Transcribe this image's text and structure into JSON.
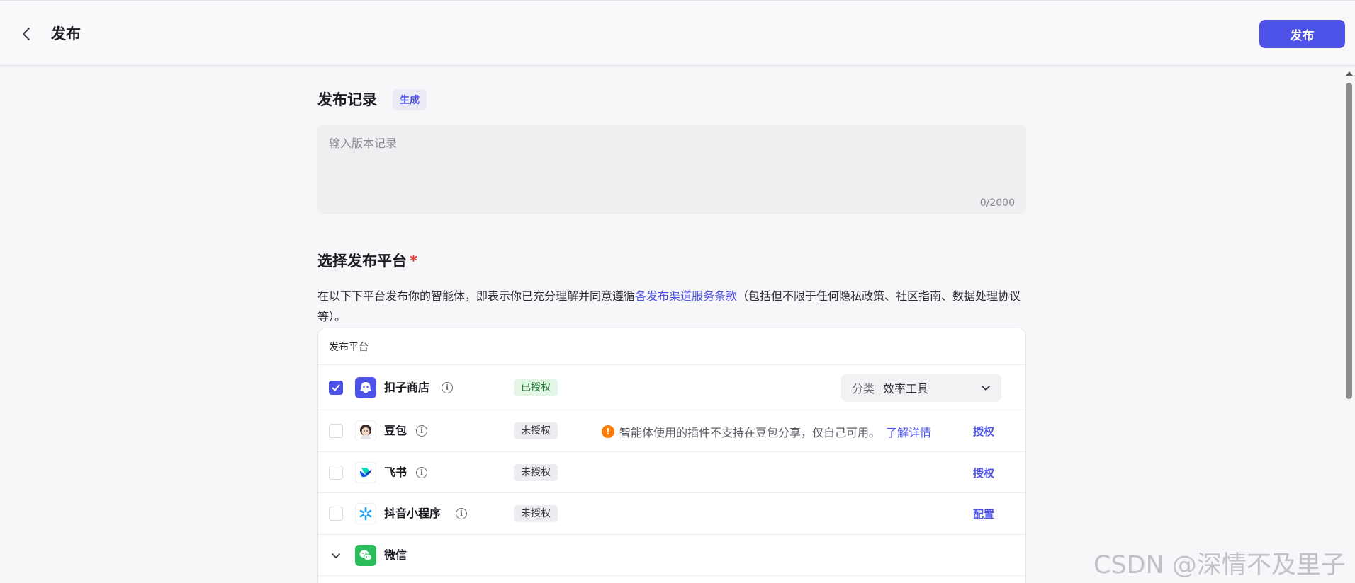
{
  "header": {
    "title": "发布",
    "publish_label": "发布"
  },
  "record": {
    "title": "发布记录",
    "generate_label": "生成",
    "placeholder": "输入版本记录",
    "counter": "0/2000"
  },
  "platforms": {
    "title": "选择发布平台",
    "required_mark": "*",
    "desc_before": "在以下下平台发布你的智能体，即表示你已充分理解并同意遵循",
    "desc_link": "各发布渠道服务条款",
    "desc_after": "（包括但不限于任何隐私政策、社区指南、数据处理协议等）。",
    "table_header": "发布平台",
    "rows": [
      {
        "name": "扣子商店",
        "status": "已授权",
        "checked": true,
        "category_label": "分类",
        "category_value": "效率工具"
      },
      {
        "name": "豆包",
        "status": "未授权",
        "checked": false,
        "warning": "智能体使用的插件不支持在豆包分享，仅自己可用。",
        "warning_link": "了解详情",
        "action": "授权"
      },
      {
        "name": "飞书",
        "status": "未授权",
        "checked": false,
        "action": "授权"
      },
      {
        "name": "抖音小程序",
        "status": "未授权",
        "checked": false,
        "action": "配置"
      },
      {
        "name": "微信"
      }
    ]
  },
  "watermark": "CSDN @深情不及里子",
  "colors": {
    "accent": "#4d53e8",
    "authorized_bg": "#e3f5e5",
    "warning": "#ff7a00"
  }
}
